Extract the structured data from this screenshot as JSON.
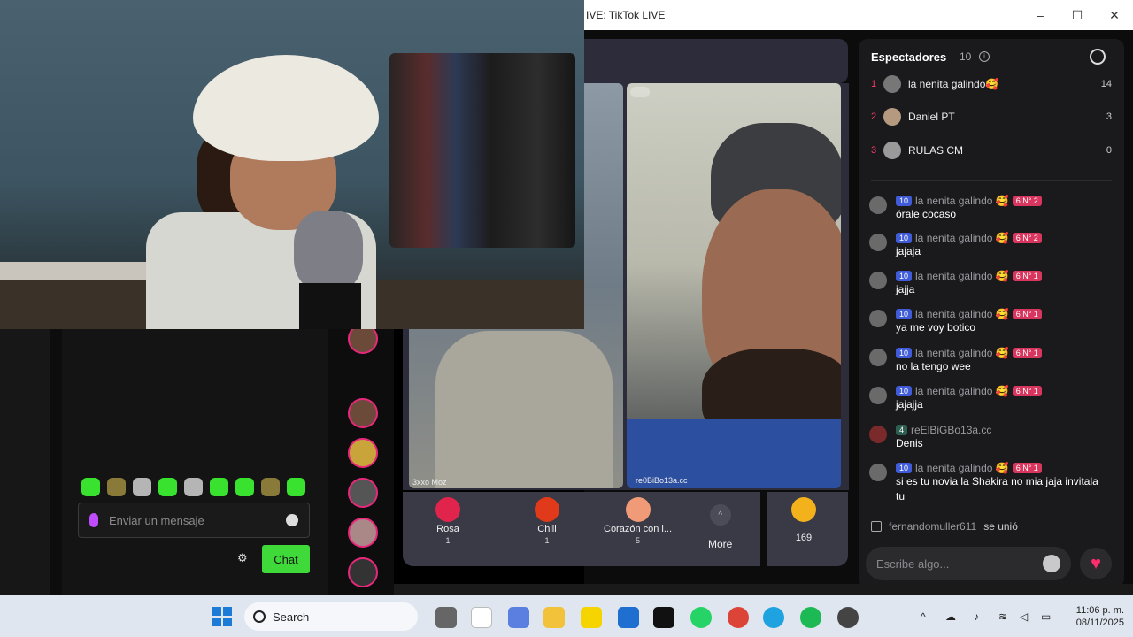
{
  "window": {
    "title": "IVE: TikTok LIVE",
    "minimize": "–",
    "maximize": "☐",
    "close": "✕"
  },
  "left_chat": {
    "placeholder": "Enviar un mensaje",
    "chat_button": "Chat"
  },
  "video_labels": {
    "left": "3xxo Moz",
    "right": "re0BiBo13a.cc"
  },
  "gifts": [
    {
      "name": "Rosa",
      "cost": "1",
      "color": "#e0244b"
    },
    {
      "name": "Chili",
      "cost": "1",
      "color": "#e03a1b"
    },
    {
      "name": "Corazón con l...",
      "cost": "5",
      "color": "#f09a78"
    },
    {
      "name": "More",
      "cost": ""
    }
  ],
  "coins": {
    "value": "169"
  },
  "viewers": {
    "title": "Espectadores",
    "count": "10",
    "list": [
      {
        "rank": "1",
        "name": "la nenita galindo🥰",
        "score": "14"
      },
      {
        "rank": "2",
        "name": "Daniel PT",
        "score": "3"
      },
      {
        "rank": "3",
        "name": "RULAS CM",
        "score": "0"
      }
    ]
  },
  "messages": [
    {
      "level": "10",
      "user": "la nenita galindo 🥰",
      "fan": "6 N° 2",
      "text": "órale cocaso"
    },
    {
      "level": "10",
      "user": "la nenita galindo 🥰",
      "fan": "6 N° 2",
      "text": "jajaja"
    },
    {
      "level": "10",
      "user": "la nenita galindo 🥰",
      "fan": "6 N° 1",
      "text": "jajja"
    },
    {
      "level": "10",
      "user": "la nenita galindo 🥰",
      "fan": "6 N° 1",
      "text": "ya me voy botico"
    },
    {
      "level": "10",
      "user": "la nenita galindo 🥰",
      "fan": "6 N° 1",
      "text": "no la tengo wee"
    },
    {
      "level": "10",
      "user": "la nenita galindo 🥰",
      "fan": "6 N° 1",
      "text": "jajajja"
    },
    {
      "level": "4",
      "user": "reElBiGBo13a.cc",
      "fan": "",
      "text": "Denis"
    },
    {
      "level": "10",
      "user": "la nenita galindo 🥰",
      "fan": "6 N° 1",
      "text": "si es tu novia la Shakira no mia jaja invitala tu"
    }
  ],
  "joined": {
    "user": "fernandomuller611",
    "text": "se unió"
  },
  "chat_input": {
    "placeholder": "Escribe algo..."
  },
  "taskbar": {
    "search_label": "Search",
    "time": "11:06 p. m.",
    "date": "08/11/2025"
  }
}
